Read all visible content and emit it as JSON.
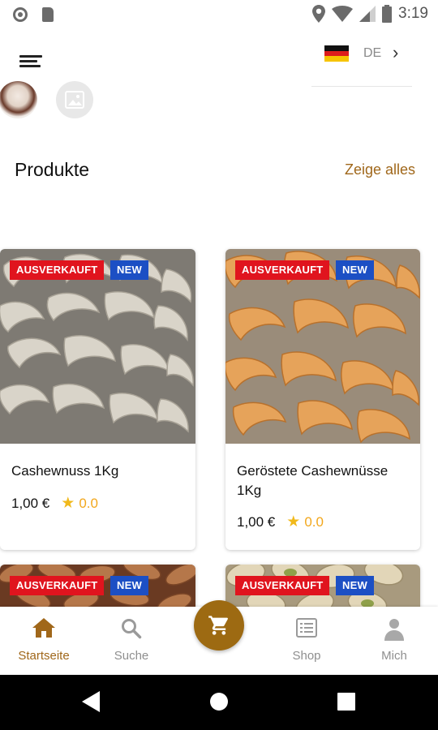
{
  "status_bar": {
    "time": "3:19"
  },
  "header": {
    "language_code": "DE"
  },
  "section": {
    "title": "Produkte",
    "see_all_label": "Zeige alles"
  },
  "products": [
    {
      "name": "Cashewnuss 1Kg",
      "price": "1,00 €",
      "rating": "0.0",
      "badges": [
        "AUSVERKAUFT",
        "NEW"
      ],
      "image": "raw-cashews"
    },
    {
      "name": "Geröstete Cashewnüsse 1Kg",
      "price": "1,00 €",
      "rating": "0.0",
      "badges": [
        "AUSVERKAUFT",
        "NEW"
      ],
      "image": "roasted-cashews"
    },
    {
      "name": "",
      "price": "",
      "rating": "",
      "badges": [
        "AUSVERKAUFT",
        "NEW"
      ],
      "image": "almonds"
    },
    {
      "name": "",
      "price": "",
      "rating": "",
      "badges": [
        "AUSVERKAUFT",
        "NEW"
      ],
      "image": "pistachios"
    }
  ],
  "bottom_nav": {
    "items": [
      {
        "label": "Startseite",
        "icon": "home-icon",
        "active": true
      },
      {
        "label": "Suche",
        "icon": "search-icon",
        "active": false
      },
      {
        "label": "Shop",
        "icon": "list-icon",
        "active": false
      },
      {
        "label": "Mich",
        "icon": "person-icon",
        "active": false
      }
    ],
    "fab_icon": "cart-icon"
  },
  "colors": {
    "accent": "#a0671a",
    "fab": "#9d6a12",
    "sold_badge": "#e0141e",
    "new_badge": "#1c4fc4",
    "star": "#f1b91b"
  }
}
